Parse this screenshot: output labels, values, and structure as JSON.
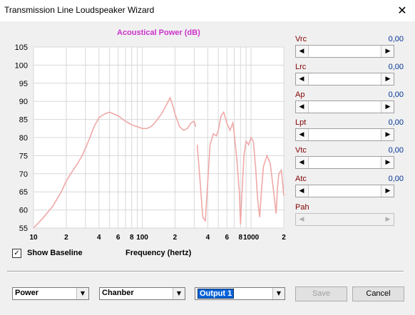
{
  "window": {
    "title": "Transmission Line Loudspeaker Wizard",
    "close_glyph": "✕"
  },
  "chart_data": {
    "type": "line",
    "title": "Acoustical Power (dB)",
    "xlabel": "Frequency (hertz)",
    "ylabel": "",
    "xscale": "log",
    "xlim": [
      10,
      2000
    ],
    "ylim": [
      55,
      105
    ],
    "y_ticks": [
      "105",
      "100",
      "95",
      "90",
      "85",
      "80",
      "75",
      "70",
      "65",
      "60",
      "55"
    ],
    "x_ticks": [
      "10",
      "2",
      "4",
      "6",
      "8",
      "100",
      "2",
      "4",
      "6",
      "8",
      "1000",
      "2"
    ],
    "grid": true,
    "series": [
      {
        "color": "#f0a8a8",
        "segments": [
          [
            [
              10,
              55
            ],
            [
              12,
              57.5
            ],
            [
              15,
              61
            ],
            [
              18,
              65
            ],
            [
              20,
              68
            ],
            [
              22,
              70
            ],
            [
              25,
              72.5
            ],
            [
              28,
              75
            ],
            [
              30,
              77
            ],
            [
              33,
              80
            ],
            [
              36,
              83
            ],
            [
              40,
              85.5
            ],
            [
              45,
              86.5
            ],
            [
              50,
              87
            ],
            [
              60,
              86
            ],
            [
              70,
              84.5
            ],
            [
              80,
              83.5
            ],
            [
              90,
              83
            ],
            [
              100,
              82.5
            ],
            [
              110,
              82.5
            ],
            [
              120,
              83
            ],
            [
              130,
              84
            ],
            [
              150,
              86.5
            ],
            [
              170,
              89.5
            ],
            [
              180,
              91
            ],
            [
              190,
              89
            ],
            [
              200,
              86.5
            ],
            [
              220,
              83
            ],
            [
              240,
              82
            ],
            [
              260,
              82.5
            ],
            [
              280,
              84
            ],
            [
              300,
              84.5
            ],
            [
              310,
              83
            ]
          ],
          [
            [
              320,
              78
            ],
            [
              340,
              68
            ],
            [
              360,
              58
            ],
            [
              380,
              57
            ],
            [
              400,
              68
            ],
            [
              420,
              78
            ],
            [
              450,
              81
            ],
            [
              480,
              80.5
            ],
            [
              500,
              82
            ],
            [
              530,
              86
            ],
            [
              560,
              87
            ],
            [
              600,
              84
            ],
            [
              640,
              82
            ],
            [
              680,
              84
            ],
            [
              700,
              81
            ],
            [
              740,
              74
            ],
            [
              780,
              65
            ],
            [
              800,
              56
            ],
            [
              820,
              63
            ],
            [
              860,
              75
            ],
            [
              900,
              79
            ],
            [
              950,
              78
            ],
            [
              1000,
              80
            ],
            [
              1050,
              79
            ],
            [
              1100,
              72
            ],
            [
              1150,
              63
            ],
            [
              1200,
              58
            ],
            [
              1250,
              66
            ],
            [
              1300,
              72
            ],
            [
              1400,
              75
            ],
            [
              1500,
              73
            ],
            [
              1600,
              66
            ],
            [
              1700,
              59
            ],
            [
              1750,
              66
            ],
            [
              1800,
              70
            ],
            [
              1900,
              71
            ],
            [
              2000,
              64
            ]
          ]
        ]
      }
    ]
  },
  "checkbox": {
    "label": "Show Baseline",
    "checked": true,
    "glyph": "✓"
  },
  "params": [
    {
      "label": "Vrc",
      "value": "0,00"
    },
    {
      "label": "Lrc",
      "value": "0,00"
    },
    {
      "label": "Ap",
      "value": "0,00"
    },
    {
      "label": "Lpt",
      "value": "0,00"
    },
    {
      "label": "Vtc",
      "value": "0,00"
    },
    {
      "label": "Atc",
      "value": "0,00"
    },
    {
      "label": "Pah",
      "value": ""
    }
  ],
  "scroll_left_glyph": "◀",
  "scroll_right_glyph": "▶",
  "combo_arrow_glyph": "▼",
  "bottom": {
    "combo1": "Power",
    "combo2": "Chanber",
    "combo3": "Output 1",
    "save_label": "Save",
    "cancel_label": "Cancel"
  }
}
